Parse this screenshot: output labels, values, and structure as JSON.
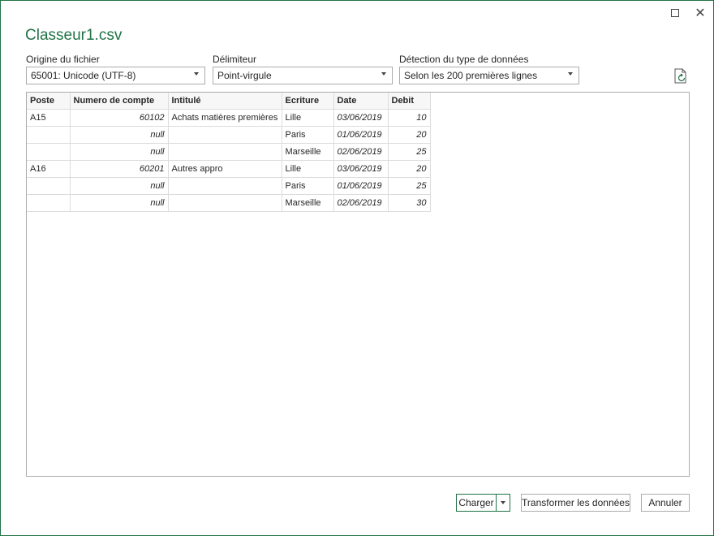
{
  "window": {
    "title": "Classeur1.csv",
    "maximize_icon": "maximize-icon",
    "close_icon": "close-icon"
  },
  "options": {
    "file_origin": {
      "label": "Origine du fichier",
      "value": "65001: Unicode (UTF-8)"
    },
    "delimiter": {
      "label": "Délimiteur",
      "value": "Point-virgule"
    },
    "type_detection": {
      "label": "Détection du type de données",
      "value": "Selon les 200 premières lignes"
    },
    "refresh_icon": "refresh-file-icon"
  },
  "table": {
    "columns": [
      "Poste",
      "Numero de compte",
      "Intitulé",
      "Ecriture",
      "Date",
      "Debit"
    ],
    "rows": [
      [
        "A15",
        "60102",
        "Achats matières premières",
        "Lille",
        "03/06/2019",
        "10"
      ],
      [
        "",
        "null",
        "",
        "Paris",
        "01/06/2019",
        "20"
      ],
      [
        "",
        "null",
        "",
        "Marseille",
        "02/06/2019",
        "25"
      ],
      [
        "A16",
        "60201",
        "Autres appro",
        "Lille",
        "03/06/2019",
        "20"
      ],
      [
        "",
        "null",
        "",
        "Paris",
        "01/06/2019",
        "25"
      ],
      [
        "",
        "null",
        "",
        "Marseille",
        "02/06/2019",
        "30"
      ]
    ]
  },
  "buttons": {
    "load": "Charger",
    "transform": "Transformer les données",
    "cancel": "Annuler"
  },
  "colors": {
    "accent": "#217346",
    "border": "#ababab",
    "grid": "#dcdcdc"
  }
}
